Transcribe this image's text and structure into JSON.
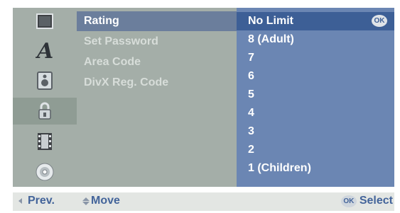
{
  "menu": {
    "items": [
      {
        "label": "Rating"
      },
      {
        "label": "Set Password"
      },
      {
        "label": "Area Code"
      },
      {
        "label": "DivX Reg. Code"
      }
    ]
  },
  "icons": [
    "display-icon",
    "language-icon",
    "audio-icon",
    "lock-icon",
    "film-icon",
    "disc-icon"
  ],
  "selected_icon": "lock-icon",
  "options": {
    "items": [
      {
        "label": "No Limit"
      },
      {
        "label": "8 (Adult)"
      },
      {
        "label": "7"
      },
      {
        "label": "6"
      },
      {
        "label": "5"
      },
      {
        "label": "4"
      },
      {
        "label": "3"
      },
      {
        "label": "2"
      },
      {
        "label": "1 (Children)"
      }
    ],
    "selected": "No Limit",
    "ok_badge": "OK"
  },
  "footer": {
    "prev": "Prev.",
    "move": "Move",
    "select": "Select",
    "ok_badge": "OK"
  },
  "colors": {
    "panel_gray": "#a4aea8",
    "panel_blue": "#6b86b3",
    "selected_blue": "#3d5f96",
    "footer_text": "#43649a"
  }
}
